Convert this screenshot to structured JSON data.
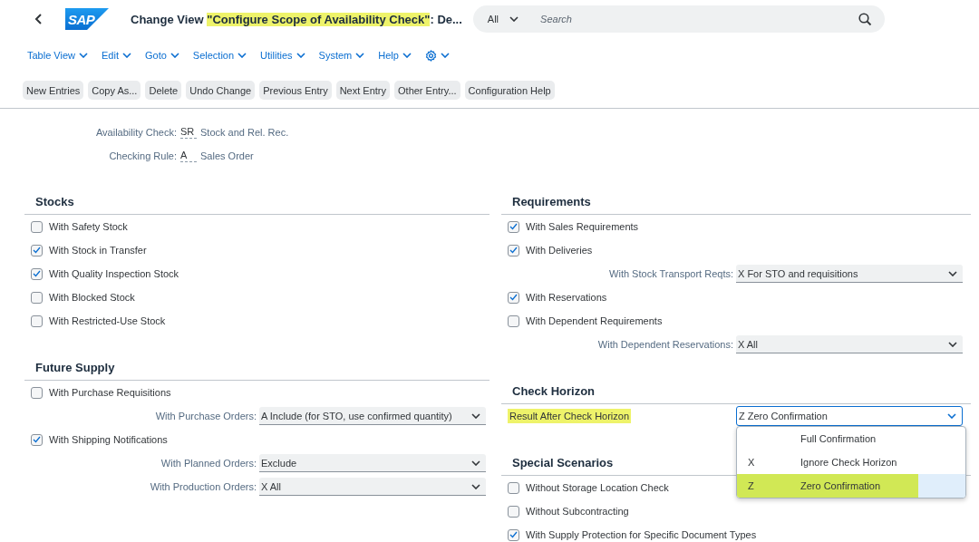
{
  "header": {
    "logo": "SAP",
    "title": {
      "before": "Change View ",
      "highlighted": "\"Configure Scope of Availability Check\"",
      "after": ": De..."
    },
    "search": {
      "scope": "All",
      "placeholder": "Search"
    }
  },
  "menu": [
    {
      "kind": "text",
      "label": "Table View"
    },
    {
      "kind": "text",
      "label": "Edit"
    },
    {
      "kind": "text",
      "label": "Goto"
    },
    {
      "kind": "text",
      "label": "Selection"
    },
    {
      "kind": "text",
      "label": "Utilities"
    },
    {
      "kind": "text",
      "label": "System"
    },
    {
      "kind": "text",
      "label": "Help"
    },
    {
      "kind": "settings"
    }
  ],
  "toolbar": [
    "New Entries",
    "Copy As...",
    "Delete",
    "Undo Change",
    "Previous Entry",
    "Next Entry",
    "Other Entry...",
    "Configuration Help"
  ],
  "key_fields": [
    {
      "label": "Availability Check:",
      "code": "SR",
      "description": "Stock and Rel. Rec."
    },
    {
      "label": "Checking Rule:",
      "code": "A",
      "description": "Sales Order"
    }
  ],
  "columns": [
    [
      {
        "title": "Stocks",
        "rows": [
          {
            "kind": "checkbox",
            "label": "With Safety Stock",
            "checked": false
          },
          {
            "kind": "checkbox",
            "label": "With Stock in Transfer",
            "checked": true
          },
          {
            "kind": "checkbox",
            "label": "With Quality Inspection Stock",
            "checked": true
          },
          {
            "kind": "checkbox",
            "label": "With Blocked Stock",
            "checked": false
          },
          {
            "kind": "checkbox",
            "label": "With Restricted-Use Stock",
            "checked": false
          }
        ]
      },
      {
        "title": "Future Supply",
        "rows": [
          {
            "kind": "checkbox",
            "label": "With Purchase Requisitions",
            "checked": false
          },
          {
            "kind": "select",
            "label": "With Purchase Orders:",
            "value": "A Include (for STO, use confirmed quantity)"
          },
          {
            "kind": "checkbox",
            "label": "With Shipping Notifications",
            "checked": true
          },
          {
            "kind": "select",
            "label": "With Planned Orders:",
            "value": "Exclude"
          },
          {
            "kind": "select",
            "label": "With Production Orders:",
            "value": "X All"
          }
        ]
      }
    ],
    [
      {
        "title": "Requirements",
        "rows": [
          {
            "kind": "checkbox",
            "label": "With Sales Requirements",
            "checked": true
          },
          {
            "kind": "checkbox",
            "label": "With Deliveries",
            "checked": true
          },
          {
            "kind": "select",
            "label": "With Stock Transport Reqts:",
            "value": "X For STO and requisitions"
          },
          {
            "kind": "checkbox",
            "label": "With Reservations",
            "checked": true
          },
          {
            "kind": "checkbox",
            "label": "With Dependent Requirements",
            "checked": false
          },
          {
            "kind": "select",
            "label": "With Dependent Reservations:",
            "value": "X All"
          }
        ]
      },
      {
        "title": "Check Horizon",
        "rows": [
          {
            "kind": "field",
            "label": "Result After Check Horizon",
            "highlighted": true,
            "value": "Z Zero Confirmation",
            "focused": true,
            "options": [
              {
                "text": "Full Confirmation",
                "selected": false,
                "highlighted": false
              },
              {
                "code": "X",
                "text": "Ignore Check Horizon",
                "selected": false,
                "highlighted": false
              },
              {
                "code": "Z",
                "text": "Zero Confirmation",
                "selected": true,
                "highlighted": true
              }
            ]
          }
        ]
      },
      {
        "title": "Special Scenarios",
        "rows": [
          {
            "kind": "checkbox",
            "label": "Without Storage Location Check",
            "checked": false
          },
          {
            "kind": "checkbox",
            "label": "Without Subcontracting",
            "checked": false
          },
          {
            "kind": "checkbox",
            "label": "With Supply Protection for Specific Document Types",
            "checked": true
          }
        ]
      }
    ]
  ]
}
